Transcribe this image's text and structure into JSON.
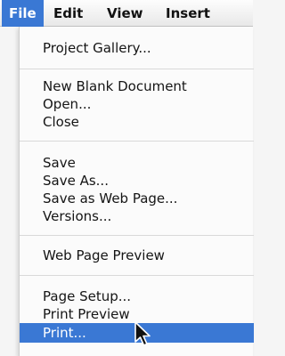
{
  "menubar": {
    "items": [
      {
        "label": "File",
        "active": true
      },
      {
        "label": "Edit",
        "active": false
      },
      {
        "label": "View",
        "active": false
      },
      {
        "label": "Insert",
        "active": false
      }
    ]
  },
  "file_menu": {
    "groups": [
      [
        "Project Gallery..."
      ],
      [
        "New Blank Document",
        "Open...",
        "Close"
      ],
      [
        "Save",
        "Save As...",
        "Save as Web Page...",
        "Versions..."
      ],
      [
        "Web Page Preview"
      ],
      [
        "Page Setup...",
        "Print Preview",
        "Print..."
      ]
    ],
    "highlighted": "Print..."
  },
  "colors": {
    "highlight": "#3a78d4",
    "menu_background": "#fbfbfb",
    "text": "#151515"
  },
  "icons": {
    "cursor": "mouse-pointer-icon"
  }
}
